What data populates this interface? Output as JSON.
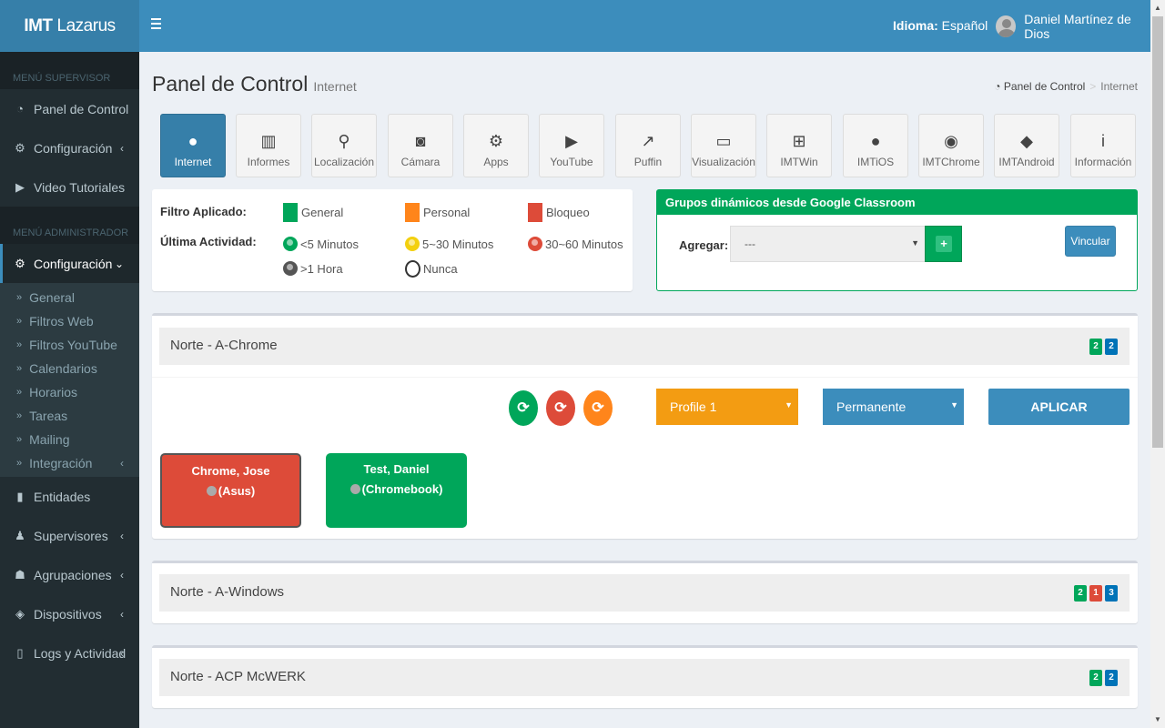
{
  "header": {
    "logo_bold": "IMT",
    "logo_rest": "Lazarus",
    "lang_label": "Idioma:",
    "lang_value": "Español",
    "user_name": "Daniel Martínez de Dios"
  },
  "sidebar": {
    "supervisor_header": "MENÚ SUPERVISOR",
    "admin_header": "MENÚ ADMINISTRADOR",
    "supervisor_items": [
      {
        "label": "Panel de Control",
        "icon": "dashboard-icon"
      },
      {
        "label": "Configuración",
        "icon": "cogs-icon"
      },
      {
        "label": "Video Tutoriales",
        "icon": "play-circle-icon"
      }
    ],
    "admin_config": "Configuración",
    "submenu": [
      "General",
      "Filtros Web",
      "Filtros YouTube",
      "Calendarios",
      "Horarios",
      "Tareas",
      "Mailing",
      "Integración"
    ],
    "admin_items": [
      {
        "label": "Entidades",
        "icon": "building-icon"
      },
      {
        "label": "Supervisores",
        "icon": "user-tie-icon"
      },
      {
        "label": "Agrupaciones",
        "icon": "users-icon"
      },
      {
        "label": "Dispositivos",
        "icon": "cube-icon"
      },
      {
        "label": "Logs y Actividad",
        "icon": "file-icon"
      }
    ]
  },
  "page": {
    "title": "Panel de Control",
    "subtitle": "Internet",
    "breadcrumb": [
      "Panel de Control",
      "Internet"
    ]
  },
  "tiles": [
    {
      "label": "Internet",
      "icon": "globe-icon",
      "active": true
    },
    {
      "label": "Informes",
      "icon": "bar-chart-icon"
    },
    {
      "label": "Localización",
      "icon": "map-marker-icon"
    },
    {
      "label": "Cámara",
      "icon": "camera-icon"
    },
    {
      "label": "Apps",
      "icon": "cogs-icon"
    },
    {
      "label": "YouTube",
      "icon": "youtube-icon"
    },
    {
      "label": "Puffin",
      "icon": "share-icon"
    },
    {
      "label": "Visualización",
      "icon": "laptop-icon"
    },
    {
      "label": "IMTWin",
      "icon": "windows-icon"
    },
    {
      "label": "IMTiOS",
      "icon": "apple-icon"
    },
    {
      "label": "IMTChrome",
      "icon": "chrome-icon"
    },
    {
      "label": "IMTAndroid",
      "icon": "android-icon"
    },
    {
      "label": "Información",
      "icon": "info-icon"
    }
  ],
  "filter": {
    "applied_label": "Filtro Aplicado:",
    "activity_label": "Última Actividad:",
    "filters": [
      {
        "label": "General",
        "color": "#00a65a"
      },
      {
        "label": "Personal",
        "color": "#ff851b"
      },
      {
        "label": "Bloqueo",
        "color": "#dd4b39"
      }
    ],
    "activity": [
      {
        "label": "<5 Minutos",
        "color": "#00a65a"
      },
      {
        "label": "5~30 Minutos",
        "color": "#f3d00f"
      },
      {
        "label": "30~60 Minutos",
        "color": "#dd4b39"
      },
      {
        "label": ">1 Hora",
        "color": "#555555"
      },
      {
        "label": "Nunca",
        "color": "#ffffff"
      }
    ]
  },
  "classroom": {
    "title": "Grupos dinámicos desde Google Classroom",
    "add_label": "Agregar:",
    "select_value": "---",
    "link_label": "Vincular"
  },
  "groups": [
    {
      "name": "Norte - A-Chrome",
      "badges": [
        {
          "value": "2",
          "color": "green"
        },
        {
          "value": "2",
          "color": "blue"
        }
      ],
      "profile": "Profile 1",
      "duration": "Permanente",
      "apply": "APLICAR",
      "devices": [
        {
          "name": "Chrome, Jose",
          "type": "(Asus)",
          "color": "#dd4b39"
        },
        {
          "name": "Test, Daniel",
          "type": "(Chromebook)",
          "color": "#00a65a"
        }
      ]
    },
    {
      "name": "Norte - A-Windows",
      "badges": [
        {
          "value": "2",
          "color": "green"
        },
        {
          "value": "1",
          "color": "red"
        },
        {
          "value": "3",
          "color": "blue"
        }
      ]
    },
    {
      "name": "Norte - ACP McWERK",
      "badges": [
        {
          "value": "2",
          "color": "green"
        },
        {
          "value": "2",
          "color": "blue"
        }
      ]
    }
  ]
}
